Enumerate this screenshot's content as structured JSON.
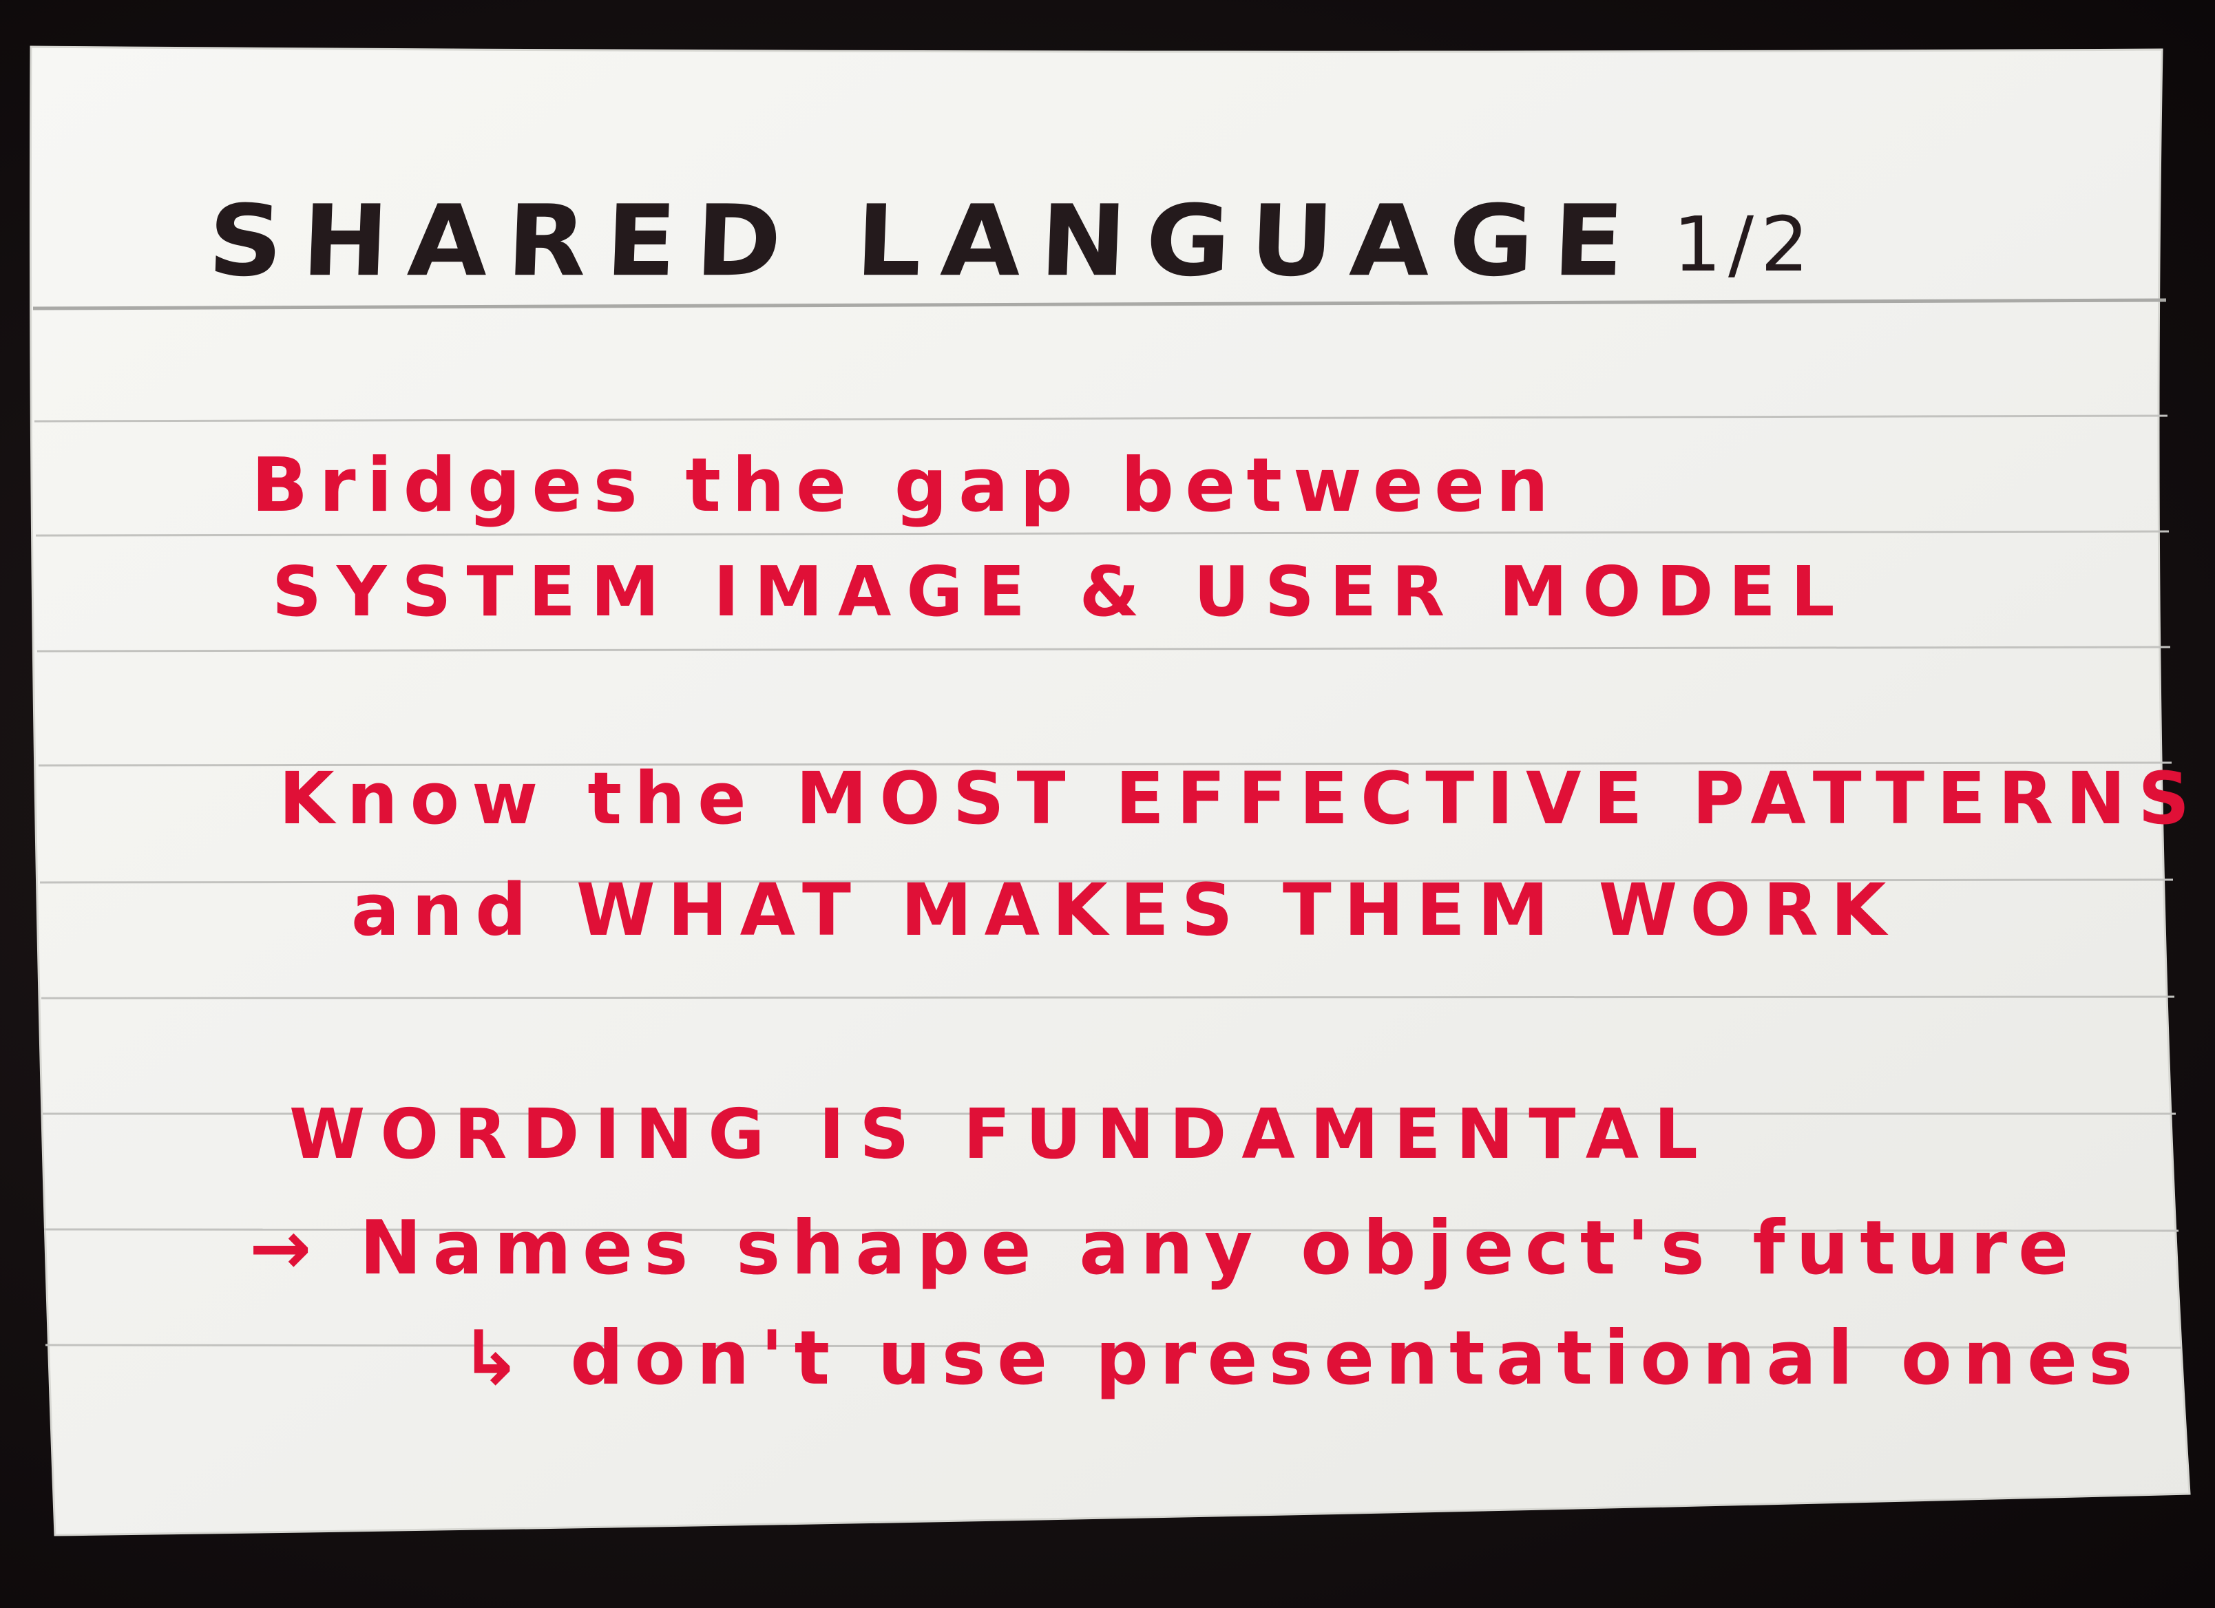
{
  "card": {
    "title": "SHARED LANGUAGE",
    "page_indicator": "1/2",
    "ink_colors": {
      "title": "#241a1c",
      "body": "#e01037"
    },
    "lines": [
      "Bridges the gap between",
      "SYSTEM IMAGE & USER MODEL",
      "Know the MOST EFFECTIVE PATTERNS",
      "and WHAT MAKES THEM WORK",
      "WORDING IS FUNDAMENTAL",
      "→ Names shape any object's future",
      "↳ don't use presentational ones"
    ]
  }
}
